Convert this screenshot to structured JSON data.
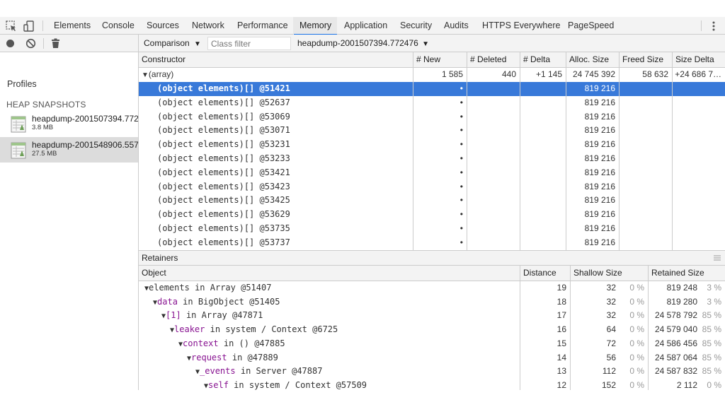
{
  "tabs": [
    "Elements",
    "Console",
    "Sources",
    "Network",
    "Performance",
    "Memory",
    "Application",
    "Security",
    "Audits",
    "HTTPS Everywhere",
    "PageSpeed"
  ],
  "active_tab": "Memory",
  "sidebar": {
    "title": "Profiles",
    "section": "HEAP SNAPSHOTS",
    "snapshots": [
      {
        "name": "heapdump-2001507394.772",
        "size": "3.8 MB"
      },
      {
        "name": "heapdump-2001548906.557",
        "size": "27.5 MB"
      }
    ]
  },
  "toolbar": {
    "view": "Comparison",
    "class_filter_placeholder": "Class filter",
    "base_snapshot": "heapdump-2001507394.772476"
  },
  "constructor_table": {
    "headers": [
      "Constructor",
      "# New",
      "# Deleted",
      "# Delta",
      "Alloc. Size",
      "Freed Size",
      "Size Delta"
    ],
    "group": {
      "name": "(array)",
      "new": "1 585",
      "deleted": "440",
      "delta": "+1 145",
      "alloc": "24 745 392",
      "freed": "58 632",
      "size_delta": "+24 686 7…"
    },
    "rows": [
      {
        "name": "(object elements)[] @51421",
        "new": "•",
        "alloc": "819 216"
      },
      {
        "name": "(object elements)[] @52637",
        "new": "•",
        "alloc": "819 216"
      },
      {
        "name": "(object elements)[] @53069",
        "new": "•",
        "alloc": "819 216"
      },
      {
        "name": "(object elements)[] @53071",
        "new": "•",
        "alloc": "819 216"
      },
      {
        "name": "(object elements)[] @53231",
        "new": "•",
        "alloc": "819 216"
      },
      {
        "name": "(object elements)[] @53233",
        "new": "•",
        "alloc": "819 216"
      },
      {
        "name": "(object elements)[] @53421",
        "new": "•",
        "alloc": "819 216"
      },
      {
        "name": "(object elements)[] @53423",
        "new": "•",
        "alloc": "819 216"
      },
      {
        "name": "(object elements)[] @53425",
        "new": "•",
        "alloc": "819 216"
      },
      {
        "name": "(object elements)[] @53629",
        "new": "•",
        "alloc": "819 216"
      },
      {
        "name": "(object elements)[] @53735",
        "new": "•",
        "alloc": "819 216"
      },
      {
        "name": "(object elements)[] @53737",
        "new": "•",
        "alloc": "819 216"
      }
    ]
  },
  "retainers": {
    "title": "Retainers",
    "headers": [
      "Object",
      "Distance",
      "Shallow Size",
      "Retained Size"
    ],
    "rows": [
      {
        "prop": "elements",
        "in": "in",
        "obj": "Array @51407",
        "distance": "19",
        "shallow": "32",
        "shallow_pct": "0 %",
        "retained": "819 248",
        "retained_pct": "3 %"
      },
      {
        "prop": "data",
        "in": "in",
        "obj": "BigObject @51405",
        "distance": "18",
        "shallow": "32",
        "shallow_pct": "0 %",
        "retained": "819 280",
        "retained_pct": "3 %"
      },
      {
        "prop": "[1]",
        "in": "in",
        "obj": "Array @47871",
        "distance": "17",
        "shallow": "32",
        "shallow_pct": "0 %",
        "retained": "24 578 792",
        "retained_pct": "85 %"
      },
      {
        "prop": "leaker",
        "in": "in",
        "obj": "system / Context @6725",
        "distance": "16",
        "shallow": "64",
        "shallow_pct": "0 %",
        "retained": "24 579 040",
        "retained_pct": "85 %"
      },
      {
        "prop": "context",
        "in": "in",
        "obj": "() @47885",
        "distance": "15",
        "shallow": "72",
        "shallow_pct": "0 %",
        "retained": "24 586 456",
        "retained_pct": "85 %"
      },
      {
        "prop": "request",
        "in": "in",
        "obj": "@47889",
        "distance": "14",
        "shallow": "56",
        "shallow_pct": "0 %",
        "retained": "24 587 064",
        "retained_pct": "85 %"
      },
      {
        "prop": "_events",
        "in": "in",
        "obj": "Server @47887",
        "distance": "13",
        "shallow": "112",
        "shallow_pct": "0 %",
        "retained": "24 587 832",
        "retained_pct": "85 %"
      },
      {
        "prop": "self",
        "in": "in",
        "obj": "system / Context @57509",
        "distance": "12",
        "shallow": "152",
        "shallow_pct": "0 %",
        "retained": "2 112",
        "retained_pct": "0 %"
      }
    ]
  },
  "colors": {
    "accent": "#1a73e8",
    "selection": "#3879d9",
    "property": "#881391"
  }
}
